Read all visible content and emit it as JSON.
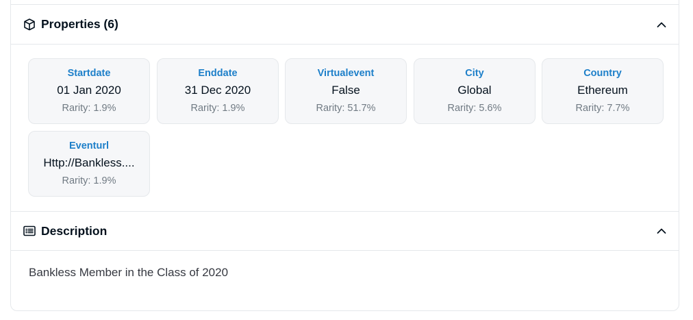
{
  "properties": {
    "title": "Properties (6)",
    "traits": [
      {
        "type": "Startdate",
        "value": "01 Jan 2020",
        "rarity": "Rarity: 1.9%"
      },
      {
        "type": "Enddate",
        "value": "31 Dec 2020",
        "rarity": "Rarity: 1.9%"
      },
      {
        "type": "Virtualevent",
        "value": "False",
        "rarity": "Rarity: 51.7%"
      },
      {
        "type": "City",
        "value": "Global",
        "rarity": "Rarity: 5.6%"
      },
      {
        "type": "Country",
        "value": "Ethereum",
        "rarity": "Rarity: 7.7%"
      },
      {
        "type": "Eventurl",
        "value": "Http://Bankless....",
        "rarity": "Rarity: 1.9%"
      }
    ]
  },
  "description": {
    "title": "Description",
    "text": "Bankless Member in the Class of 2020"
  },
  "icons": {
    "properties": "cube-icon",
    "description": "list-icon",
    "collapse": "chevron-up-icon"
  }
}
